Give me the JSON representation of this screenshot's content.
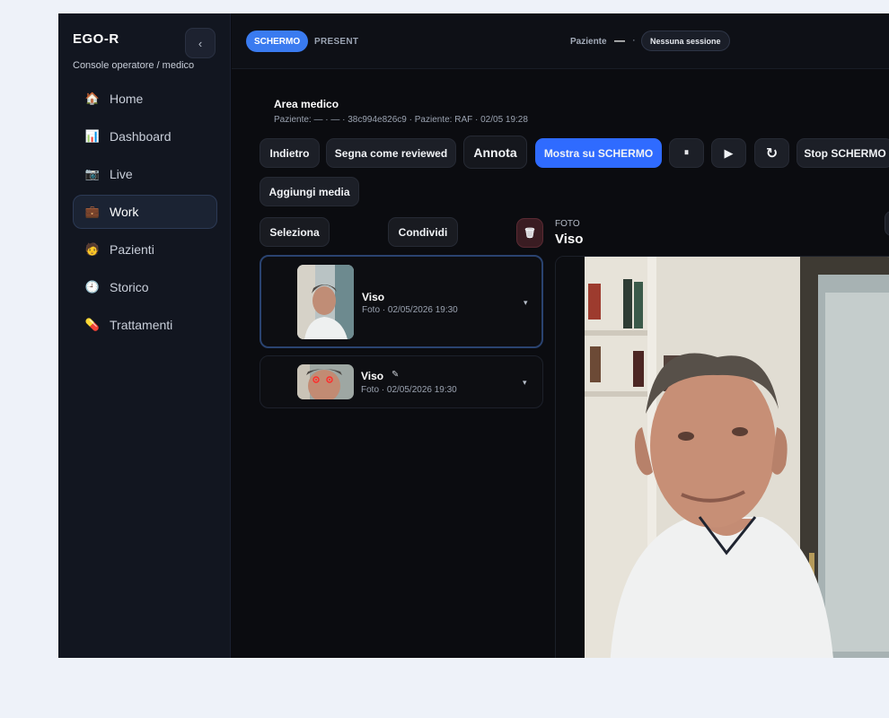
{
  "sidebar": {
    "brand": "EGO-R",
    "subtitle": "Console operatore / medico",
    "collapse_icon": "‹",
    "items": [
      {
        "label": "Home",
        "icon": "🏠"
      },
      {
        "label": "Dashboard",
        "icon": "📊"
      },
      {
        "label": "Live",
        "icon": "📷"
      },
      {
        "label": "Work",
        "icon": "💼"
      },
      {
        "label": "Pazienti",
        "icon": "🧑"
      },
      {
        "label": "Storico",
        "icon": "🕘"
      },
      {
        "label": "Trattamenti",
        "icon": "💊"
      }
    ]
  },
  "topbar": {
    "tab_schermo": "SCHERMO",
    "tab_present": "PRESENT",
    "patient_label": "Paziente",
    "patient_value": "—",
    "patient_sep": "·",
    "session": "Nessuna sessione"
  },
  "main": {
    "title": "Area medico",
    "subtitle": "Paziente: — · — · 38c994e826c9 · Paziente: RAF · 02/05 19:28",
    "buttons": {
      "back": "Indietro",
      "reviewed": "Segna come reviewed",
      "annota": "Annota",
      "show": "Mostra su SCHERMO",
      "pause": "⏸",
      "play": "▶",
      "refresh": "↻",
      "stop": "Stop SCHERMO",
      "add_media": "Aggiungi media",
      "select": "Seleziona",
      "share": "Condividi",
      "delete": "🗑"
    },
    "media": [
      {
        "title": "Viso",
        "meta": "Foto · 02/05/2026 19:30",
        "chevron": "▾"
      },
      {
        "title": "Viso",
        "meta": "Foto · 02/05/2026 19:30",
        "chevron": "▾",
        "edit_icon": "✎"
      }
    ],
    "viewer": {
      "kicker": "FOTO",
      "title": "Viso"
    }
  }
}
